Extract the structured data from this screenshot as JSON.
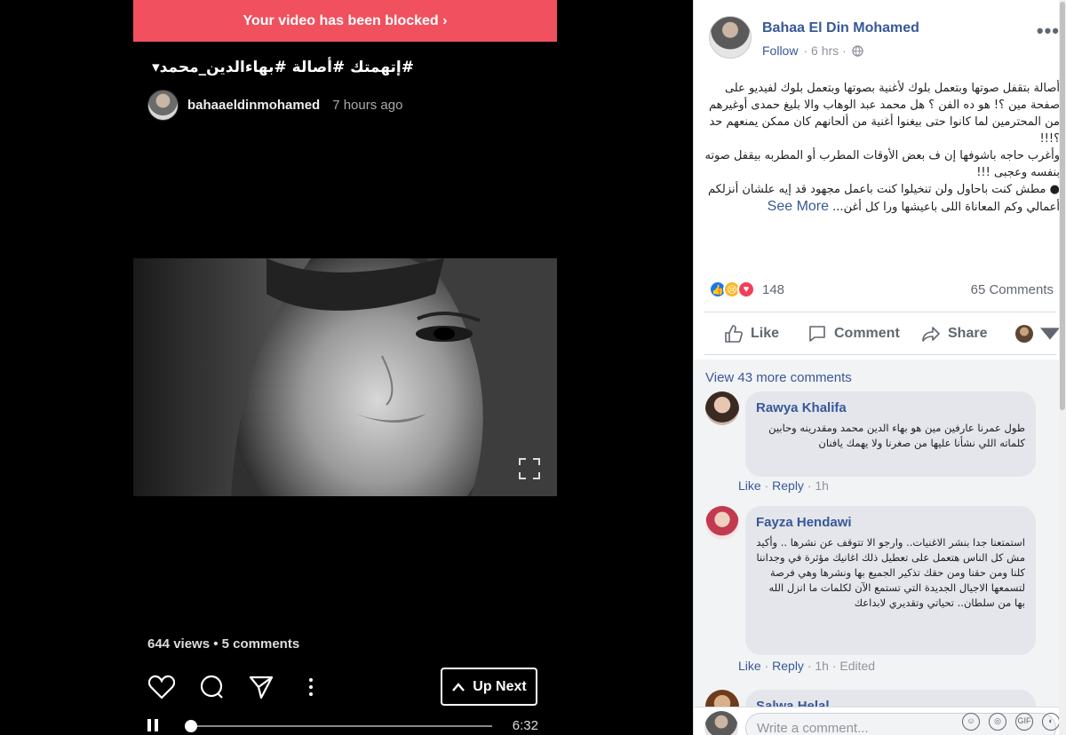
{
  "video": {
    "banner": "Your video has been blocked ›",
    "hashtags": "#إتهمتك #أصالة #بهاءالدين_محمد▾",
    "author": "bahaaeldinmohamed",
    "posted": "7 hours ago",
    "views_line": "644 views • 5 comments",
    "up_next": "Up Next",
    "duration": "6:32",
    "progress_fraction": 0.01
  },
  "post": {
    "author": "Bahaa El Din Mohamed",
    "follow": "Follow",
    "time": "· 6 hrs ·",
    "more": "•••",
    "body": [
      "أصالة بتقفل صوتها وبتعمل بلوك لأغنية بصوتها وبتعمل بلوك لفيديو على صفحة مين ؟! هو ده الفن ؟ هل محمد عبد الوهاب والا بليغ حمدى أوغيرهم من المحترمين لما كانوا حتى بيغنوا أغنية من ألحانهم كان ممكن يمنعهم حد ؟!!!",
      "وأغرب حاجه باشوفها إن ف بعض الأوقات المطرب أو المطربه بيقفل صوته بنفسه وعجبى !!!",
      "● مطش كنت باحاول ولن تنخيلوا كنت باعمل مجهود قد إيه علشان أنزلكم أعمالي وكم المعاناة اللى باعيشها ورا كل أغن..."
    ],
    "see_more": "See More",
    "reaction_count": "148",
    "comments_count": "65 Comments",
    "actions": {
      "like": "Like",
      "comment": "Comment",
      "share": "Share"
    }
  },
  "comments": {
    "view_more": "View 43 more comments",
    "items": [
      {
        "name": "Rawya Khalifa",
        "text": "طول عمرنا عارفين مين هو بهاء الدين محمد ومقدرينه وحابين كلماته اللي نشأنا عليها من صغرنا ولا يهمك يافنان",
        "like": "Like",
        "reply": "Reply",
        "meta": "· 1h"
      },
      {
        "name": "Fayza Hendawi",
        "text": "استمتعنا جدا بنشر الاغنيات.. وارجو الا تتوقف عن نشرها .. وأكيد مش كل الناس هتعمل على تعطيل ذلك اغانيك مؤثرة في وجداننا كلنا ومن حقنا ومن حقك تذكير الجميع بها ونشرها وهي فرصة لتسمعها الاجيال الجديدة التي تستمع الآن لكلمات ما انزل الله بها من سلطان.. تحياتي وتقديري لابداعك",
        "like": "Like",
        "reply": "Reply",
        "meta": "· 1h · Edited"
      }
    ],
    "partial_name": "Salwa Helal",
    "compose_placeholder": "Write a comment..."
  }
}
